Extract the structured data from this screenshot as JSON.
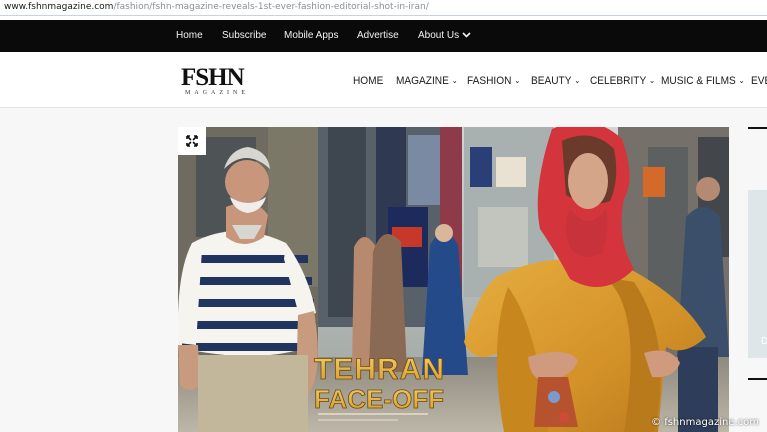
{
  "browser": {
    "url_domain": "www.fshnmagazine.com",
    "url_path": "/fashion/fshn-magazine-reveals-1st-ever-fashion-editorial-shot-in-iran/"
  },
  "top_nav": {
    "items": [
      "Home",
      "Subscribe",
      "Mobile Apps",
      "Advertise",
      "About Us"
    ]
  },
  "logo": {
    "title": "FSHN",
    "subtitle": "MAGAZINE"
  },
  "main_nav": {
    "items": [
      "HOME",
      "MAGAZINE",
      "FASHION",
      "BEAUTY",
      "CELEBRITY",
      "MUSIC & FILMS",
      "EVEN"
    ]
  },
  "hero": {
    "headline_line1": "TEHRAN",
    "headline_line2": "FACE-OFF",
    "expand_icon": "expand-arrows-icon"
  },
  "sidebar": {
    "thumb_letter": "D"
  },
  "credit": "© fshnmagazine.com",
  "colors": {
    "top_nav_bg": "#0a0a0a",
    "headline": "#e8b84a",
    "scarf": "#d8383e",
    "coat": "#d99a2e"
  }
}
